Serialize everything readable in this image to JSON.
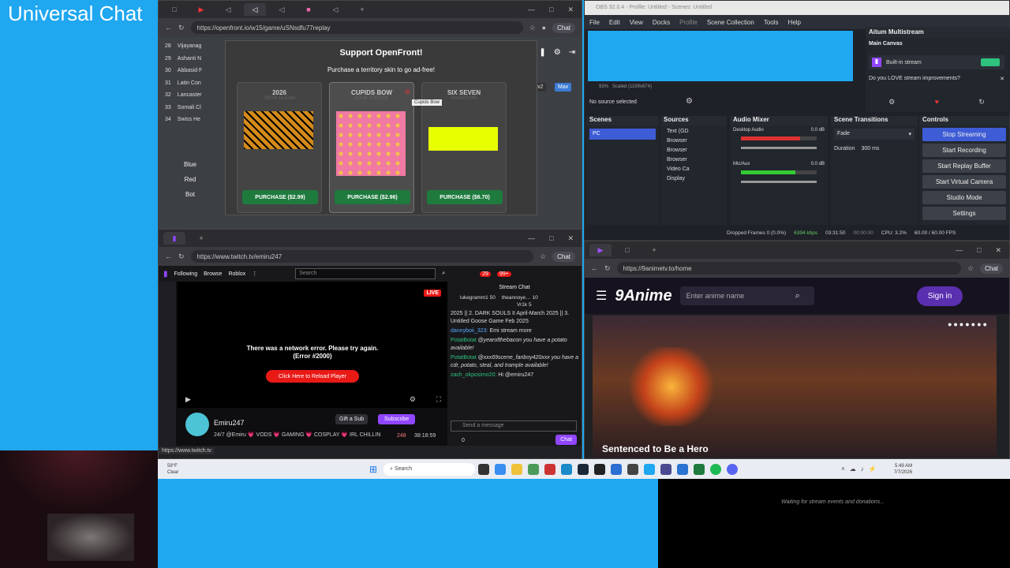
{
  "page_title": "Universal Chat",
  "openfront": {
    "url": "https://openfront.io/w15/game/uSNsdfu77replay",
    "chat_label": "Chat",
    "leaderboard": [
      {
        "rank": "28",
        "name": "Vijayanag"
      },
      {
        "rank": "29",
        "name": "Ashanti N"
      },
      {
        "rank": "30",
        "name": "Abbasid F"
      },
      {
        "rank": "31",
        "name": "Latin Con"
      },
      {
        "rank": "32",
        "name": "Lancaster"
      },
      {
        "rank": "33",
        "name": "Somali Cl"
      },
      {
        "rank": "34",
        "name": "Swiss He"
      }
    ],
    "teams": [
      "Blue",
      "Red",
      "Bot"
    ],
    "modal_title": "Support OpenFront!",
    "modal_subtitle": "Purchase a territory skin to go ad-free!",
    "tooltip": "Cupids Bow",
    "side_text": "ed",
    "multiplier": "x2",
    "max_label": "Max",
    "skins": [
      {
        "name": "2026",
        "sub": "ONYX GLEAM",
        "price": "PURCHASE ($2.99)",
        "color": "#d48a1a"
      },
      {
        "name": "CUPIDS BOW",
        "sub": "LOVE STRUCK",
        "price": "PURCHASE ($2.96)",
        "color": "#f07aa3"
      },
      {
        "name": "SIX SEVEN",
        "sub": "RADIATION",
        "price": "PURCHASE ($6.70)",
        "color": "#e8ff00"
      }
    ]
  },
  "obs": {
    "title": "OBS 32.0.4 - Profile: Untitled - Scenes: Untitled",
    "menu": [
      "File",
      "Edit",
      "View",
      "Docks",
      "Profile",
      "Scene Collection",
      "Tools",
      "Help"
    ],
    "zoom": "93%",
    "scaled": "Scaled (1199x674)",
    "no_source": "No source selected",
    "aitum_title": "Aitum Multistream",
    "main_canvas": "Main Canvas",
    "built_in": "Built-in stream",
    "improve_msg": "Do you LOVE stream improvements?",
    "scenes_title": "Scenes",
    "scenes": [
      "PC"
    ],
    "sources_title": "Sources",
    "sources": [
      "Text (GD",
      "Browser",
      "Browser",
      "Browser",
      "Video Ca",
      "Display"
    ],
    "mixer_title": "Audio Mixer",
    "mixer": [
      {
        "name": "Desktop Audio",
        "level": "0.0 dB",
        "fill": 0.78,
        "color": "#d33"
      },
      {
        "name": "Mic/Aux",
        "level": "0.0 dB",
        "fill": 0.72,
        "color": "#3c3"
      }
    ],
    "transitions_title": "Scene Transitions",
    "transition": "Fade",
    "duration_label": "Duration",
    "duration": "300 ms",
    "controls_title": "Controls",
    "controls": [
      "Stop Streaming",
      "Start Recording",
      "Start Replay Buffer",
      "Start Virtual Camera",
      "Studio Mode",
      "Settings"
    ],
    "status": {
      "dropped": "Dropped Frames 0 (0.0%)",
      "kbps": "6394 kbps",
      "live_time": "03:31:50",
      "rec_time": "00:00:00",
      "cpu": "CPU: 3.2%",
      "fps": "60.00 / 60.00 FPS"
    }
  },
  "twitch": {
    "url": "https://www.twitch.tv/emiru247",
    "nav": [
      "Following",
      "Browse",
      "Roblox"
    ],
    "search_placeholder": "Search",
    "badge1": "29",
    "badge2": "99+",
    "live": "LIVE",
    "error_line1": "There was a network error. Please try again.",
    "error_line2": "(Error #2000)",
    "reload": "Click Here to Reload Player",
    "chat_title": "Stream Chat",
    "gifters": [
      {
        "name": "lukegramm1",
        "count": "50"
      },
      {
        "name": "theannoye…",
        "count": "10"
      },
      {
        "name": "Vr1k",
        "count": "5"
      }
    ],
    "messages": [
      {
        "user": "",
        "text": "2025 || 2. DARK SOULS II April-March 2025 || 3. Untitled Goose Game Feb 2025"
      },
      {
        "user": "dannyboii_323:",
        "text": "Emi stream more"
      },
      {
        "user": "PotatBotat",
        "text": "@yearofthebacon you have a potato available!"
      },
      {
        "user": "PotatBotat",
        "text": "@xxx69scene_fanboy420xxx you have a cdr, potato, steal, and trample available!"
      },
      {
        "user": "zach_okposimo20:",
        "text": "Hi @emiru247"
      }
    ],
    "send_placeholder": "Send a message",
    "points": "0",
    "chat_btn": "Chat",
    "streamer": "Emiru247",
    "stream_title": "24/7 @Emiru 💗 VODS 💗 GAMING 💗 COSPLAY 💗 IRL CHILLIN",
    "viewers": "248",
    "uptime": "38:18:59",
    "gift": "Gift a Sub",
    "subscribe": "Subscribe",
    "status_url": "https://www.twitch.tv"
  },
  "anime": {
    "url": "https://9animetv.to/home",
    "logo": "9Anime",
    "search_placeholder": "Enter anime name",
    "signin": "Sign in",
    "banner_title": "Sentenced to Be a Hero"
  },
  "taskbar": {
    "weather_temp": "59°F",
    "weather_desc": "Clear",
    "search": "Search",
    "time": "5:49 AM",
    "date": "7/7/2026"
  },
  "donations": {
    "waiting": "Waiting for stream events and donations..."
  }
}
